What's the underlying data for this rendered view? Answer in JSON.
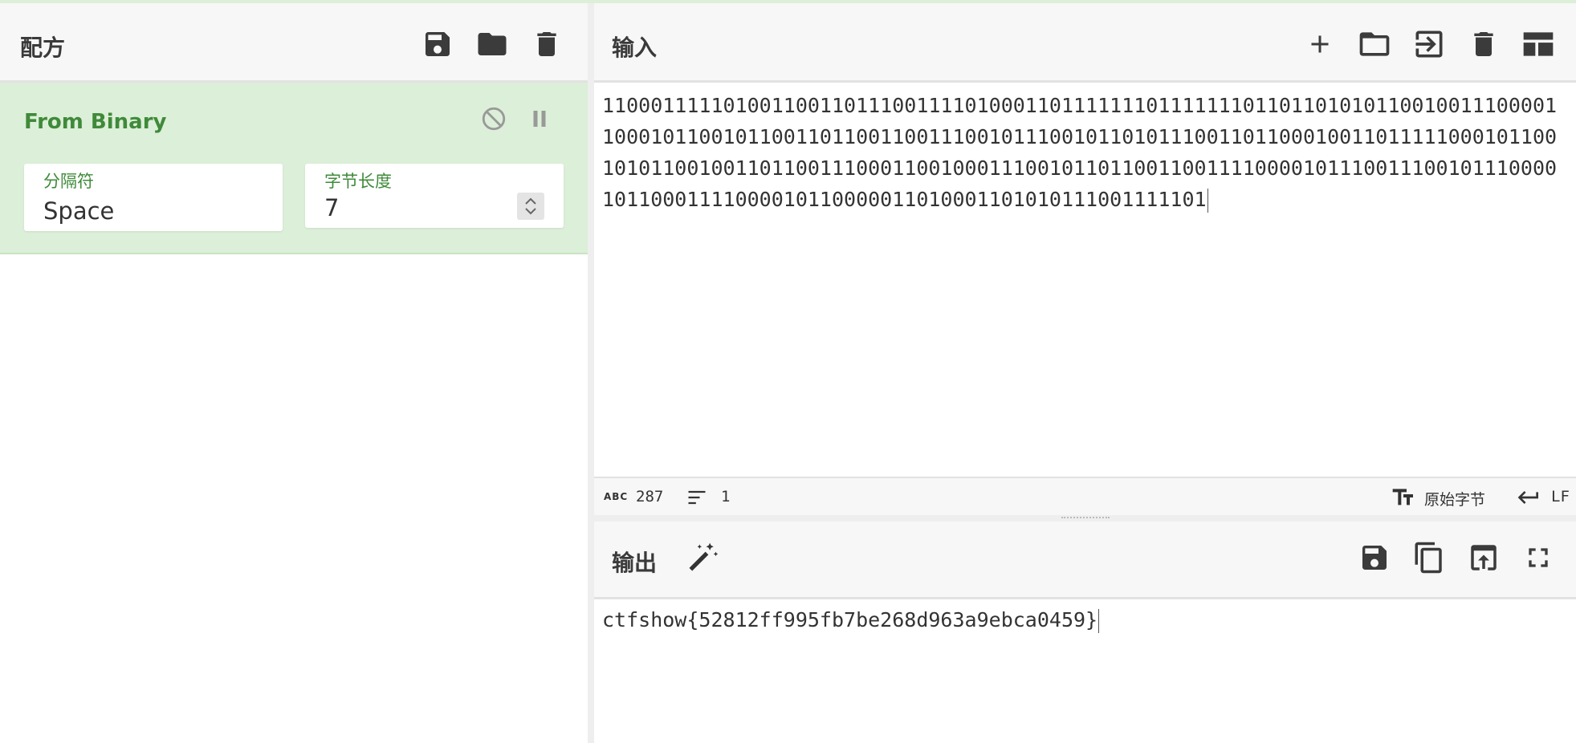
{
  "recipe": {
    "title": "配方",
    "icons": [
      "save-icon",
      "folder-icon",
      "trash-icon"
    ],
    "operation": {
      "name": "From Binary",
      "delimiter_label": "分隔符",
      "delimiter_value": "Space",
      "byte_length_label": "字节长度",
      "byte_length_value": "7"
    }
  },
  "input": {
    "title": "输入",
    "icons": [
      "plus-icon",
      "folder-icon",
      "import-icon",
      "trash-icon",
      "layout-icon"
    ],
    "text": "11000111110100110011011100111101000110111111101111111011011010101100100111000011000101100101100110110011001110010111001011010111001101100010011011111000101100101011001001101100111000110010001110010110110011001111000010111001110010111000010110001111000010110000011010001101010111001111101",
    "status": {
      "abc_label": "ABC",
      "length": "287",
      "lines": "1",
      "encoding": "原始字节",
      "eol": "LF"
    }
  },
  "output": {
    "title": "输出",
    "icons": [
      "magic-wand-icon",
      "save-icon",
      "copy-icon",
      "replace-input-icon",
      "fullscreen-icon"
    ],
    "text": "ctfshow{52812ff995fb7be268d963a9ebca0459}"
  },
  "colors": {
    "accent_green": "#3f8a3a",
    "operation_bg": "#dcefd8",
    "header_bg": "#f7f7f7"
  }
}
